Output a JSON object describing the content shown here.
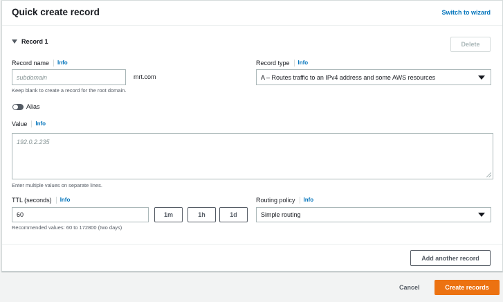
{
  "header": {
    "title": "Quick create record",
    "switch_link": "Switch to wizard"
  },
  "record": {
    "section_title": "Record 1",
    "delete_label": "Delete",
    "record_name": {
      "label": "Record name",
      "info": "Info",
      "placeholder": "subdomain",
      "value": "",
      "suffix": "mrt.com",
      "hint": "Keep blank to create a record for the root domain."
    },
    "record_type": {
      "label": "Record type",
      "info": "Info",
      "selected": "A – Routes traffic to an IPv4 address and some AWS resources"
    },
    "alias": {
      "label": "Alias",
      "enabled": false
    },
    "value": {
      "label": "Value",
      "info": "Info",
      "placeholder": "192.0.2.235",
      "hint": "Enter multiple values on separate lines."
    },
    "ttl": {
      "label": "TTL (seconds)",
      "info": "Info",
      "value": "60",
      "presets": [
        "1m",
        "1h",
        "1d"
      ],
      "hint": "Recommended values: 60 to 172800 (two days)"
    },
    "routing": {
      "label": "Routing policy",
      "info": "Info",
      "selected": "Simple routing"
    }
  },
  "add_record_label": "Add another record",
  "footer": {
    "cancel_label": "Cancel",
    "create_label": "Create records"
  },
  "colors": {
    "accent_link": "#0073bb",
    "primary_button": "#ec7211"
  }
}
